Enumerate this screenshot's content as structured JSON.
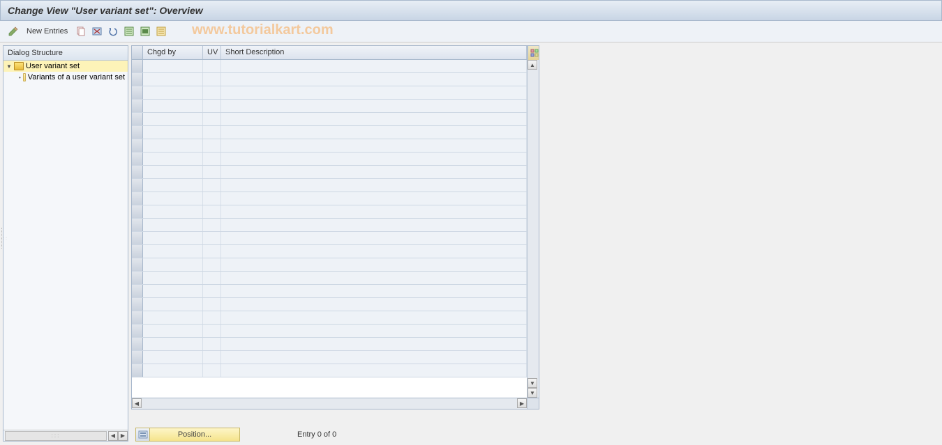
{
  "title": "Change View \"User variant set\": Overview",
  "toolbar": {
    "new_entries_label": "New Entries"
  },
  "watermark": "www.tutorialkart.com",
  "sidebar": {
    "header": "Dialog Structure",
    "items": [
      {
        "label": "User variant set",
        "selected": true,
        "expanded": true,
        "open": true
      },
      {
        "label": "Variants of a user variant set",
        "selected": false,
        "child": true,
        "open": false
      }
    ]
  },
  "table": {
    "columns": [
      {
        "key": "chgd_by",
        "label": "Chgd by"
      },
      {
        "key": "uv",
        "label": "UV"
      },
      {
        "key": "short_desc",
        "label": "Short Description"
      }
    ],
    "rows_count": 24
  },
  "footer": {
    "position_label": "Position...",
    "entry_label": "Entry 0 of 0"
  }
}
